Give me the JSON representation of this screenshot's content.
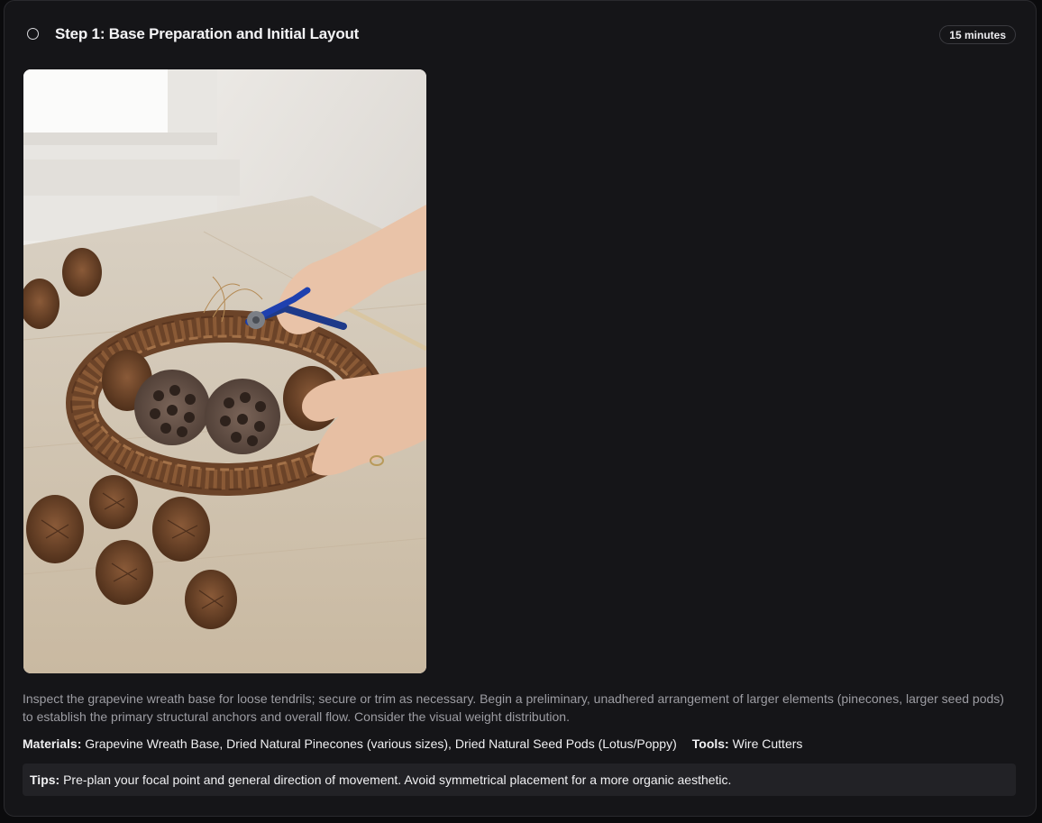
{
  "step": {
    "title": "Step 1: Base Preparation and Initial Layout",
    "duration": "15 minutes",
    "completed": false
  },
  "image": {
    "alt": "Hands trimming a grapevine wreath with wire cutters, pinecones and lotus seed pods on a wooden table"
  },
  "description": "Inspect the grapevine wreath base for loose tendrils; secure or trim as necessary. Begin a preliminary, unadhered arrangement of larger elements (pinecones, larger seed pods) to establish the primary structural anchors and overall flow. Consider the visual weight distribution.",
  "materials": {
    "label": "Materials:",
    "value": "Grapevine Wreath Base, Dried Natural Pinecones (various sizes), Dried Natural Seed Pods (Lotus/Poppy)"
  },
  "tools": {
    "label": "Tools:",
    "value": "Wire Cutters"
  },
  "tips": {
    "label": "Tips:",
    "value": "Pre-plan your focal point and general direction of movement. Avoid symmetrical placement for a more organic aesthetic."
  },
  "colors": {
    "background": "#151518",
    "tips_background": "#222226",
    "text_primary": "#f0f0f2",
    "text_muted": "#9d9da3"
  }
}
